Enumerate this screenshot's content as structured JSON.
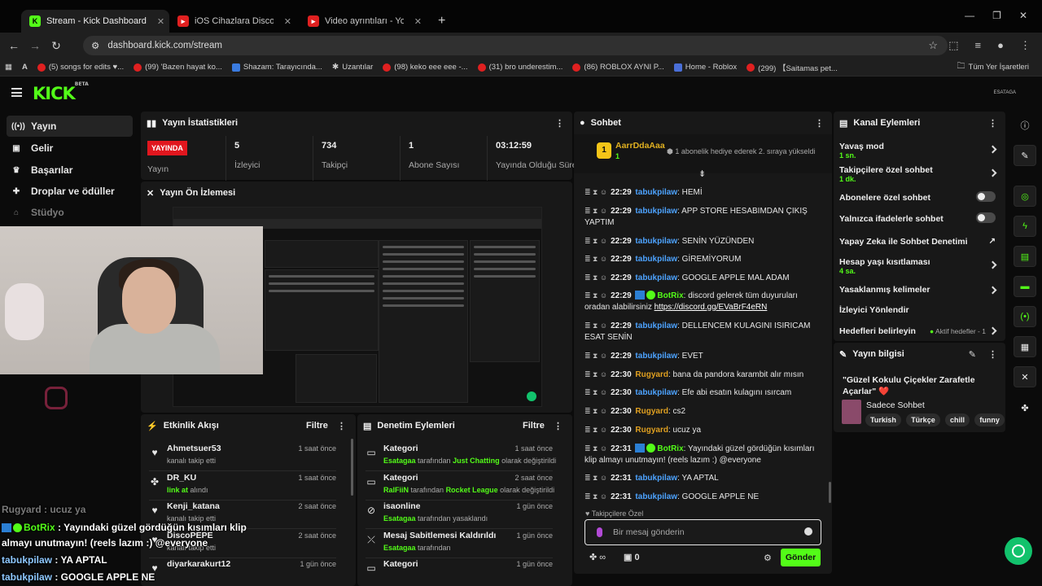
{
  "browser": {
    "tabs": [
      {
        "title": "Stream - Kick Dashboard",
        "active": true
      },
      {
        "title": "iOS Cihazlara Discord Nasıl İndir",
        "active": false
      },
      {
        "title": "Video ayrıntıları - YouTube Stud",
        "active": false
      }
    ],
    "url": "dashboard.kick.com/stream",
    "bookmarks": [
      "(5) songs for edits ♥...",
      "(99) 'Bazen hayat ko...",
      "Shazam: Tarayıcında...",
      "Uzantılar",
      "(98) keko eee eee -...",
      "(31) bro underestim...",
      "(86) ROBLOX AYNI P...",
      "Home - Roblox",
      "(299) 【Saitamas pet...",
      "Tüm Yer İşaretleri"
    ]
  },
  "header": {
    "logo": "KICK",
    "logo_beta": "BETA",
    "user": "ESATAGA"
  },
  "sidebar": {
    "items": [
      {
        "label": "Yayın",
        "icon": "broadcast-icon"
      },
      {
        "label": "Gelir",
        "icon": "wallet-icon"
      },
      {
        "label": "Başarılar",
        "icon": "trophy-icon"
      },
      {
        "label": "Droplar ve ödüller",
        "icon": "gift-icon"
      },
      {
        "label": "Stüdyo",
        "icon": "studio-icon"
      }
    ]
  },
  "stats": {
    "title": "Yayın İstatistikleri",
    "live_badge": "YAYINDA",
    "live_label": "Yayın",
    "items": [
      {
        "value": "5",
        "label": "İzleyici"
      },
      {
        "value": "734",
        "label": "Takipçi"
      },
      {
        "value": "1",
        "label": "Abone Sayısı"
      },
      {
        "value": "03:12:59",
        "label": "Yayında Olduğu Süre"
      }
    ]
  },
  "preview": {
    "title": "Yayın Ön İzlemesi"
  },
  "events": {
    "title": "Etkinlik Akışı",
    "filter": "Filtre",
    "rows": [
      {
        "name": "Ahmetsuer53",
        "sub": "kanalı takip etti",
        "time": "1 saat önce",
        "icon": "heart-icon"
      },
      {
        "name": "DR_KU",
        "sub_hl": "link at",
        "sub": " alındı",
        "time": "1 saat önce",
        "icon": "gift-icon"
      },
      {
        "name": "Kenji_katana",
        "sub": "kanalı takip etti",
        "time": "2 saat önce",
        "icon": "heart-icon"
      },
      {
        "name": "DiscoPEPE",
        "sub": "kanalı takip etti",
        "time": "2 saat önce",
        "icon": "heart-icon"
      },
      {
        "name": "diyarkarakurt12",
        "sub": "",
        "time": "1 gün önce",
        "icon": "heart-icon"
      }
    ]
  },
  "moderation": {
    "title": "Denetim Eylemleri",
    "filter": "Filtre",
    "rows": [
      {
        "name": "Kategori",
        "by": "Esatagaa",
        "mid": " tarafından ",
        "hl": "Just Chatting",
        "end": " olarak değiştirildi",
        "time": "1 saat önce",
        "icon": "category-icon"
      },
      {
        "name": "Kategori",
        "by": "RalFiiN",
        "mid": " tarafından ",
        "hl": "Rocket League",
        "end": " olarak değiştirildi",
        "time": "2 saat önce",
        "icon": "category-icon"
      },
      {
        "name": "isaonline",
        "by": "Esatagaa",
        "mid": " tarafından yasaklandı",
        "hl": "",
        "end": "",
        "time": "1 gün önce",
        "icon": "ban-icon"
      },
      {
        "name": "Mesaj Sabitlemesi Kaldırıldı",
        "by": "Esatagaa",
        "mid": " tarafından",
        "hl": "",
        "end": "",
        "time": "1 gün önce",
        "icon": "unpin-icon"
      },
      {
        "name": "Kategori",
        "by": "",
        "mid": "",
        "hl": "",
        "end": "",
        "time": "1 gün önce",
        "icon": "category-icon"
      }
    ]
  },
  "chat": {
    "title": "Sohbet",
    "pinned_user": "AarrDdaAaa",
    "pinned_count": "1",
    "pinned_text": "1 abonelik hediye ederek 2. sıraya yükseldi",
    "messages": [
      {
        "time": "22:29",
        "user": "tabukpilaw",
        "type": "tab",
        "text": ": HEMİ"
      },
      {
        "time": "22:29",
        "user": "tabukpilaw",
        "type": "tab",
        "text": ": APP STORE HESABIMDAN ÇIKIŞ YAPTIM"
      },
      {
        "time": "22:29",
        "user": "tabukpilaw",
        "type": "tab",
        "text": ": SENİN YÜZÜNDEN"
      },
      {
        "time": "22:29",
        "user": "tabukpilaw",
        "type": "tab",
        "text": ": GİREMİYORUM"
      },
      {
        "time": "22:29",
        "user": "tabukpilaw",
        "type": "tab",
        "text": ": GOOGLE APPLE MAL ADAM"
      },
      {
        "time": "22:29",
        "user": "BotRix",
        "type": "bot",
        "text": ": discord gelerek tüm duyuruları oradan alabilirsiniz ",
        "link": "https://discord.gg/EVaBrF4eRN"
      },
      {
        "time": "22:29",
        "user": "tabukpilaw",
        "type": "tab",
        "text": ": DELLENCEM KULAGINI ISIRICAM ESAT SENİN"
      },
      {
        "time": "22:29",
        "user": "tabukpilaw",
        "type": "tab",
        "text": ": EVET"
      },
      {
        "time": "22:30",
        "user": "Rugyard",
        "type": "rug",
        "text": ": bana da pandora karambit alır mısın"
      },
      {
        "time": "22:30",
        "user": "tabukpilaw",
        "type": "tab",
        "text": ": Efe abi esatın kulagını ısırcam"
      },
      {
        "time": "22:30",
        "user": "Rugyard",
        "type": "rug",
        "text": ": cs2"
      },
      {
        "time": "22:30",
        "user": "Rugyard",
        "type": "rug",
        "text": ": ucuz ya"
      },
      {
        "time": "22:31",
        "user": "BotRix",
        "type": "bot",
        "text": ": Yayındaki güzel gördüğün kısımları klip almayı unutmayın! (reels lazım :) @everyone"
      },
      {
        "time": "22:31",
        "user": "tabukpilaw",
        "type": "tab",
        "text": ": YA APTAL"
      },
      {
        "time": "22:31",
        "user": "tabukpilaw",
        "type": "tab",
        "text": ": GOOGLE APPLE NE"
      }
    ],
    "mode_label": "Takipçilere Özel",
    "placeholder": "Bir mesaj gönderin",
    "points": "0",
    "send": "Gönder"
  },
  "channel_actions": {
    "title": "Kanal Eylemleri",
    "rows": [
      {
        "label": "Yavaş mod",
        "sub": "1 sn.",
        "control": "chevron"
      },
      {
        "label": "Takipçilere özel sohbet",
        "sub": "1 dk.",
        "control": "chevron"
      },
      {
        "label": "Abonelere özel sohbet",
        "sub": "",
        "control": "toggle"
      },
      {
        "label": "Yalnızca ifadelerle sohbet",
        "sub": "",
        "control": "toggle"
      },
      {
        "label": "Yapay Zeka ile Sohbet Denetimi",
        "sub": "",
        "control": "external"
      },
      {
        "label": "Hesap yaşı kısıtlaması",
        "sub": "4 sa.",
        "control": "chevron"
      },
      {
        "label": "Yasaklanmış kelimeler",
        "sub": "",
        "control": "chevron"
      },
      {
        "label": "İzleyici Yönlendir",
        "sub": "",
        "control": "none"
      },
      {
        "label": "Hedefleri belirleyin",
        "sub": "",
        "control": "goal"
      }
    ],
    "goal_text": "Aktif hedefler - 1"
  },
  "stream_info": {
    "title": "Yayın bilgisi",
    "stream_title": "\"Güzel Kokulu Çiçekler Zarafetle Açarlar\" ❤️",
    "category": "Sadece Sohbet",
    "tags": [
      "Turkish",
      "Türkçe",
      "chill",
      "funny"
    ]
  },
  "overlay": {
    "lines": [
      {
        "user": "Rugyard",
        "text": " : ucuz ya",
        "type": "rug"
      },
      {
        "user": "BotRix",
        "text": " : Yayındaki güzel gördüğün kısımları klip",
        "type": "bot"
      },
      {
        "user": "",
        "text": "almayı unutmayın! (reels lazım :) @everyone",
        "type": "plain"
      },
      {
        "user": "tabukpilaw",
        "text": " : YA APTAL",
        "type": "tab"
      },
      {
        "user": "tabukpilaw",
        "text": " : GOOGLE APPLE NE",
        "type": "tab"
      }
    ]
  },
  "colors": {
    "accent": "#53fc18",
    "live": "#e1161e",
    "panel": "#181818",
    "background": "#0b0b0b"
  }
}
